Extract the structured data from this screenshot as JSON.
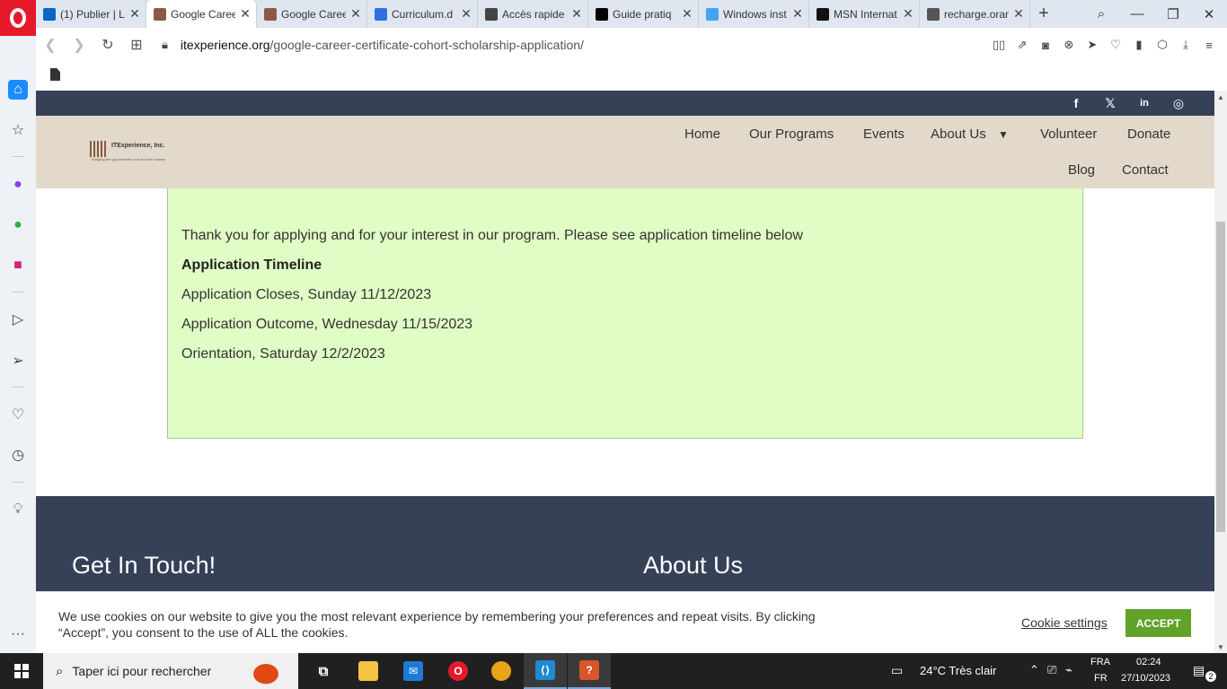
{
  "browser": {
    "tabs": [
      {
        "label": "(1) Publier | L",
        "icon": "linkedin-icon",
        "color": "#0a66c2"
      },
      {
        "label": "Google Caree",
        "icon": "itexperience-icon",
        "color": "#8a5a44",
        "active": true
      },
      {
        "label": "Google Caree",
        "icon": "itexperience-icon",
        "color": "#8a5a44"
      },
      {
        "label": "Curriculum.d",
        "icon": "google-docs-icon",
        "color": "#2f6fe4"
      },
      {
        "label": "Accès rapide",
        "icon": "grid-icon",
        "color": "#444444"
      },
      {
        "label": "Guide pratiq",
        "icon": "medium-icon",
        "color": "#000000"
      },
      {
        "label": "Windows inst",
        "icon": "flutter-icon",
        "color": "#42a5f5"
      },
      {
        "label": "MSN Internat",
        "icon": "msn-icon",
        "color": "#111111"
      },
      {
        "label": "recharge.oran",
        "icon": "globe-icon",
        "color": "#555555"
      }
    ],
    "url_host": "itexperience.org",
    "url_path": "/google-career-certificate-cohort-scholarship-application/"
  },
  "site": {
    "logo_name": "ITExperience, Inc.",
    "logo_tagline": "Bridging the gap between you and the industry",
    "nav": {
      "home": "Home",
      "programs": "Our Programs",
      "events": "Events",
      "about": "About Us",
      "volunteer": "Volunteer",
      "donate": "Donate",
      "blog": "Blog",
      "contact": "Contact"
    },
    "social": {
      "facebook": "f",
      "x": "𝕏",
      "linkedin": "in",
      "instagram": "◎"
    }
  },
  "notice": {
    "intro": "Thank you for applying and for your interest in our program. Please see application timeline below",
    "heading": "Application Timeline",
    "closes": "Application Closes, Sunday 11/12/2023",
    "outcome": "Application Outcome, Wednesday 11/15/2023",
    "orientation": "Orientation, Saturday 12/2/2023"
  },
  "footer": {
    "contact_heading": "Get In Touch!",
    "about_heading": "About Us"
  },
  "cookie": {
    "text": "We use cookies on our website to give you the most relevant experience by remembering your preferences and repeat visits. By clicking “Accept”, you consent to the use of ALL the cookies.",
    "settings_label": "Cookie settings",
    "accept_label": "ACCEPT",
    "accept_color": "#61a229"
  },
  "taskbar": {
    "search_placeholder": "Taper ici pour rechercher",
    "weather": "24°C  Très clair",
    "lang_top": "FRA",
    "lang_bottom": "FR",
    "time": "02:24",
    "date": "27/10/2023",
    "notifications": "2"
  }
}
